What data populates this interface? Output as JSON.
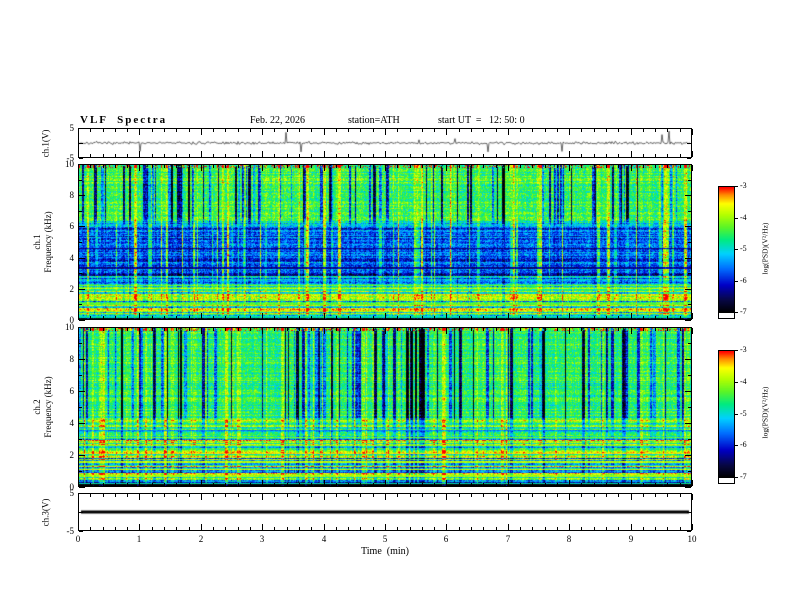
{
  "header": {
    "title": "VLF  Spectra",
    "date": "Feb. 22, 2026",
    "station": "station=ATH",
    "start_ut": "start UT  =   12: 50: 0"
  },
  "axes": {
    "x_label": "Time  (min)",
    "x_ticks": [
      "0",
      "1",
      "2",
      "3",
      "4",
      "5",
      "6",
      "7",
      "8",
      "9",
      "10"
    ],
    "freq_ticks": [
      "0",
      "2",
      "4",
      "6",
      "8",
      "10"
    ],
    "volt_ticks_top": "5",
    "volt_ticks_bottom": "-5"
  },
  "panels": {
    "ch1_voltage_label": "ch.1(V)",
    "ch1_spec_label": "ch.1\nFrequency  (kHz)",
    "ch2_spec_label": "ch.2\nFrequency  (kHz)",
    "ch3_voltage_label": "ch.3(V)"
  },
  "colorbar": {
    "label": "log(PSD)(V²/Hz)",
    "ticks": [
      "-3",
      "-4",
      "-5",
      "-6",
      "-7"
    ],
    "value_range": [
      -7,
      -3
    ],
    "colors_top_to_bottom": [
      "#ff0000",
      "#ff8c00",
      "#ffff00",
      "#5af028",
      "#00d2ff",
      "#006eff",
      "#0000c8",
      "#000000"
    ]
  },
  "chart_data": [
    {
      "id": "ch1_waveform",
      "type": "line",
      "ylabel": "ch.1(V)",
      "x_range_min": [
        0,
        10
      ],
      "y_range_V": [
        -5,
        5
      ],
      "seed": 7,
      "summary": "Broadband noise near 0 V with frequent impulsive spikes reaching about ±4 V across the full 10 minutes"
    },
    {
      "id": "ch1_spectrogram",
      "type": "heatmap",
      "x_range_min": [
        0,
        10
      ],
      "y_range_kHz": [
        0,
        10
      ],
      "value_label": "log(PSD)(V²/Hz)",
      "value_range": [
        -7,
        -3
      ],
      "seed": 11,
      "base_profile": [
        [
          0,
          -7.3
        ],
        [
          0.16,
          -7.3
        ],
        [
          0.24,
          -4.55
        ],
        [
          0.5,
          -4.5
        ],
        [
          0.9,
          -4.9
        ],
        [
          2.4,
          -5.0
        ],
        [
          2.9,
          -5.85
        ],
        [
          5.9,
          -5.85
        ],
        [
          6.5,
          -4.4
        ],
        [
          10,
          -4.3
        ]
      ],
      "row_variability": [
        [
          0,
          0.25
        ],
        [
          0.3,
          1.2
        ],
        [
          2.4,
          1.5
        ],
        [
          3.0,
          0.55
        ],
        [
          6.0,
          0.45
        ],
        [
          6.6,
          0.3
        ],
        [
          10,
          0.3
        ]
      ],
      "dark_streaks": [
        [
          0,
          0.8
        ],
        [
          2.4,
          0.8
        ],
        [
          3.0,
          0.4
        ],
        [
          6.0,
          0.4
        ],
        [
          6.6,
          3.2
        ],
        [
          10,
          3.4
        ]
      ],
      "bright_streaks": [
        [
          0,
          1.1
        ],
        [
          2.4,
          1.2
        ],
        [
          3.0,
          2.6
        ],
        [
          5.9,
          2.6
        ],
        [
          6.6,
          0.9
        ],
        [
          10,
          0.9
        ]
      ],
      "spectral_lines": [
        {
          "f": 1.95,
          "v": -3.9,
          "w": 0.05
        },
        {
          "f": 0.95,
          "v": -4.3,
          "w": 0.05
        },
        {
          "f": 0.1,
          "v": -4.9,
          "w": 0.04
        },
        {
          "f": 3.3,
          "v": -6.4,
          "w": 0.05
        },
        {
          "f": 4.6,
          "v": -6.4,
          "w": 0.04
        },
        {
          "f": 2.15,
          "v": -4.2,
          "w": 0.04
        }
      ],
      "summary": "Green/yellow band 6-10 kHz cut by dark impulsive vertical streaks; blue 2.5-6 kHz with bright sferic streaks; banded cyan/green below 2.5 kHz; black below ~0.2 kHz; red specks at the 10 kHz edge"
    },
    {
      "id": "ch2_spectrogram",
      "type": "heatmap",
      "x_range_min": [
        0,
        10
      ],
      "y_range_kHz": [
        0,
        10
      ],
      "value_label": "log(PSD)(V²/Hz)",
      "value_range": [
        -7,
        -3
      ],
      "seed": 23,
      "base_profile": [
        [
          0,
          -7.3
        ],
        [
          0.18,
          -7.3
        ],
        [
          0.28,
          -4.7
        ],
        [
          4.0,
          -4.55
        ],
        [
          4.5,
          -4.45
        ],
        [
          10,
          -4.4
        ]
      ],
      "row_variability": [
        [
          0,
          0.3
        ],
        [
          0.35,
          1.35
        ],
        [
          3.9,
          1.35
        ],
        [
          4.5,
          0.32
        ],
        [
          10,
          0.3
        ]
      ],
      "dark_streaks": [
        [
          0,
          1.0
        ],
        [
          3.9,
          1.1
        ],
        [
          4.5,
          3.0
        ],
        [
          10,
          3.2
        ]
      ],
      "bright_streaks": [
        [
          0,
          1.2
        ],
        [
          3.9,
          1.2
        ],
        [
          4.5,
          0.8
        ],
        [
          10,
          0.8
        ]
      ],
      "spectral_lines": [
        {
          "f": 2.05,
          "v": -3.5,
          "w": 0.05
        },
        {
          "f": 1.5,
          "v": -3.9,
          "w": 0.05
        },
        {
          "f": 1.0,
          "v": -3.8,
          "w": 0.04
        },
        {
          "f": 0.6,
          "v": -4.0,
          "w": 0.04
        },
        {
          "f": 2.55,
          "v": -4.1,
          "w": 0.04
        },
        {
          "f": 3.05,
          "v": -4.2,
          "w": 0.04
        },
        {
          "f": 3.5,
          "v": -5.6,
          "w": 0.04
        },
        {
          "f": 0.12,
          "v": -4.9,
          "w": 0.03
        }
      ],
      "summary": "Green band 4-10 kHz with dark vertical streaks; strong horizontal green/yellow/red spectral line banding below ~4 kHz (bright line near 2 kHz); black band below ~0.25 kHz"
    },
    {
      "id": "ch3_waveform",
      "type": "line",
      "ylabel": "ch.3(V)",
      "x_range_min": [
        0,
        10
      ],
      "y_range_V": [
        -5,
        5
      ],
      "seed": 3,
      "summary": "Constant 0 V flat thick black line (channel inactive)"
    }
  ]
}
